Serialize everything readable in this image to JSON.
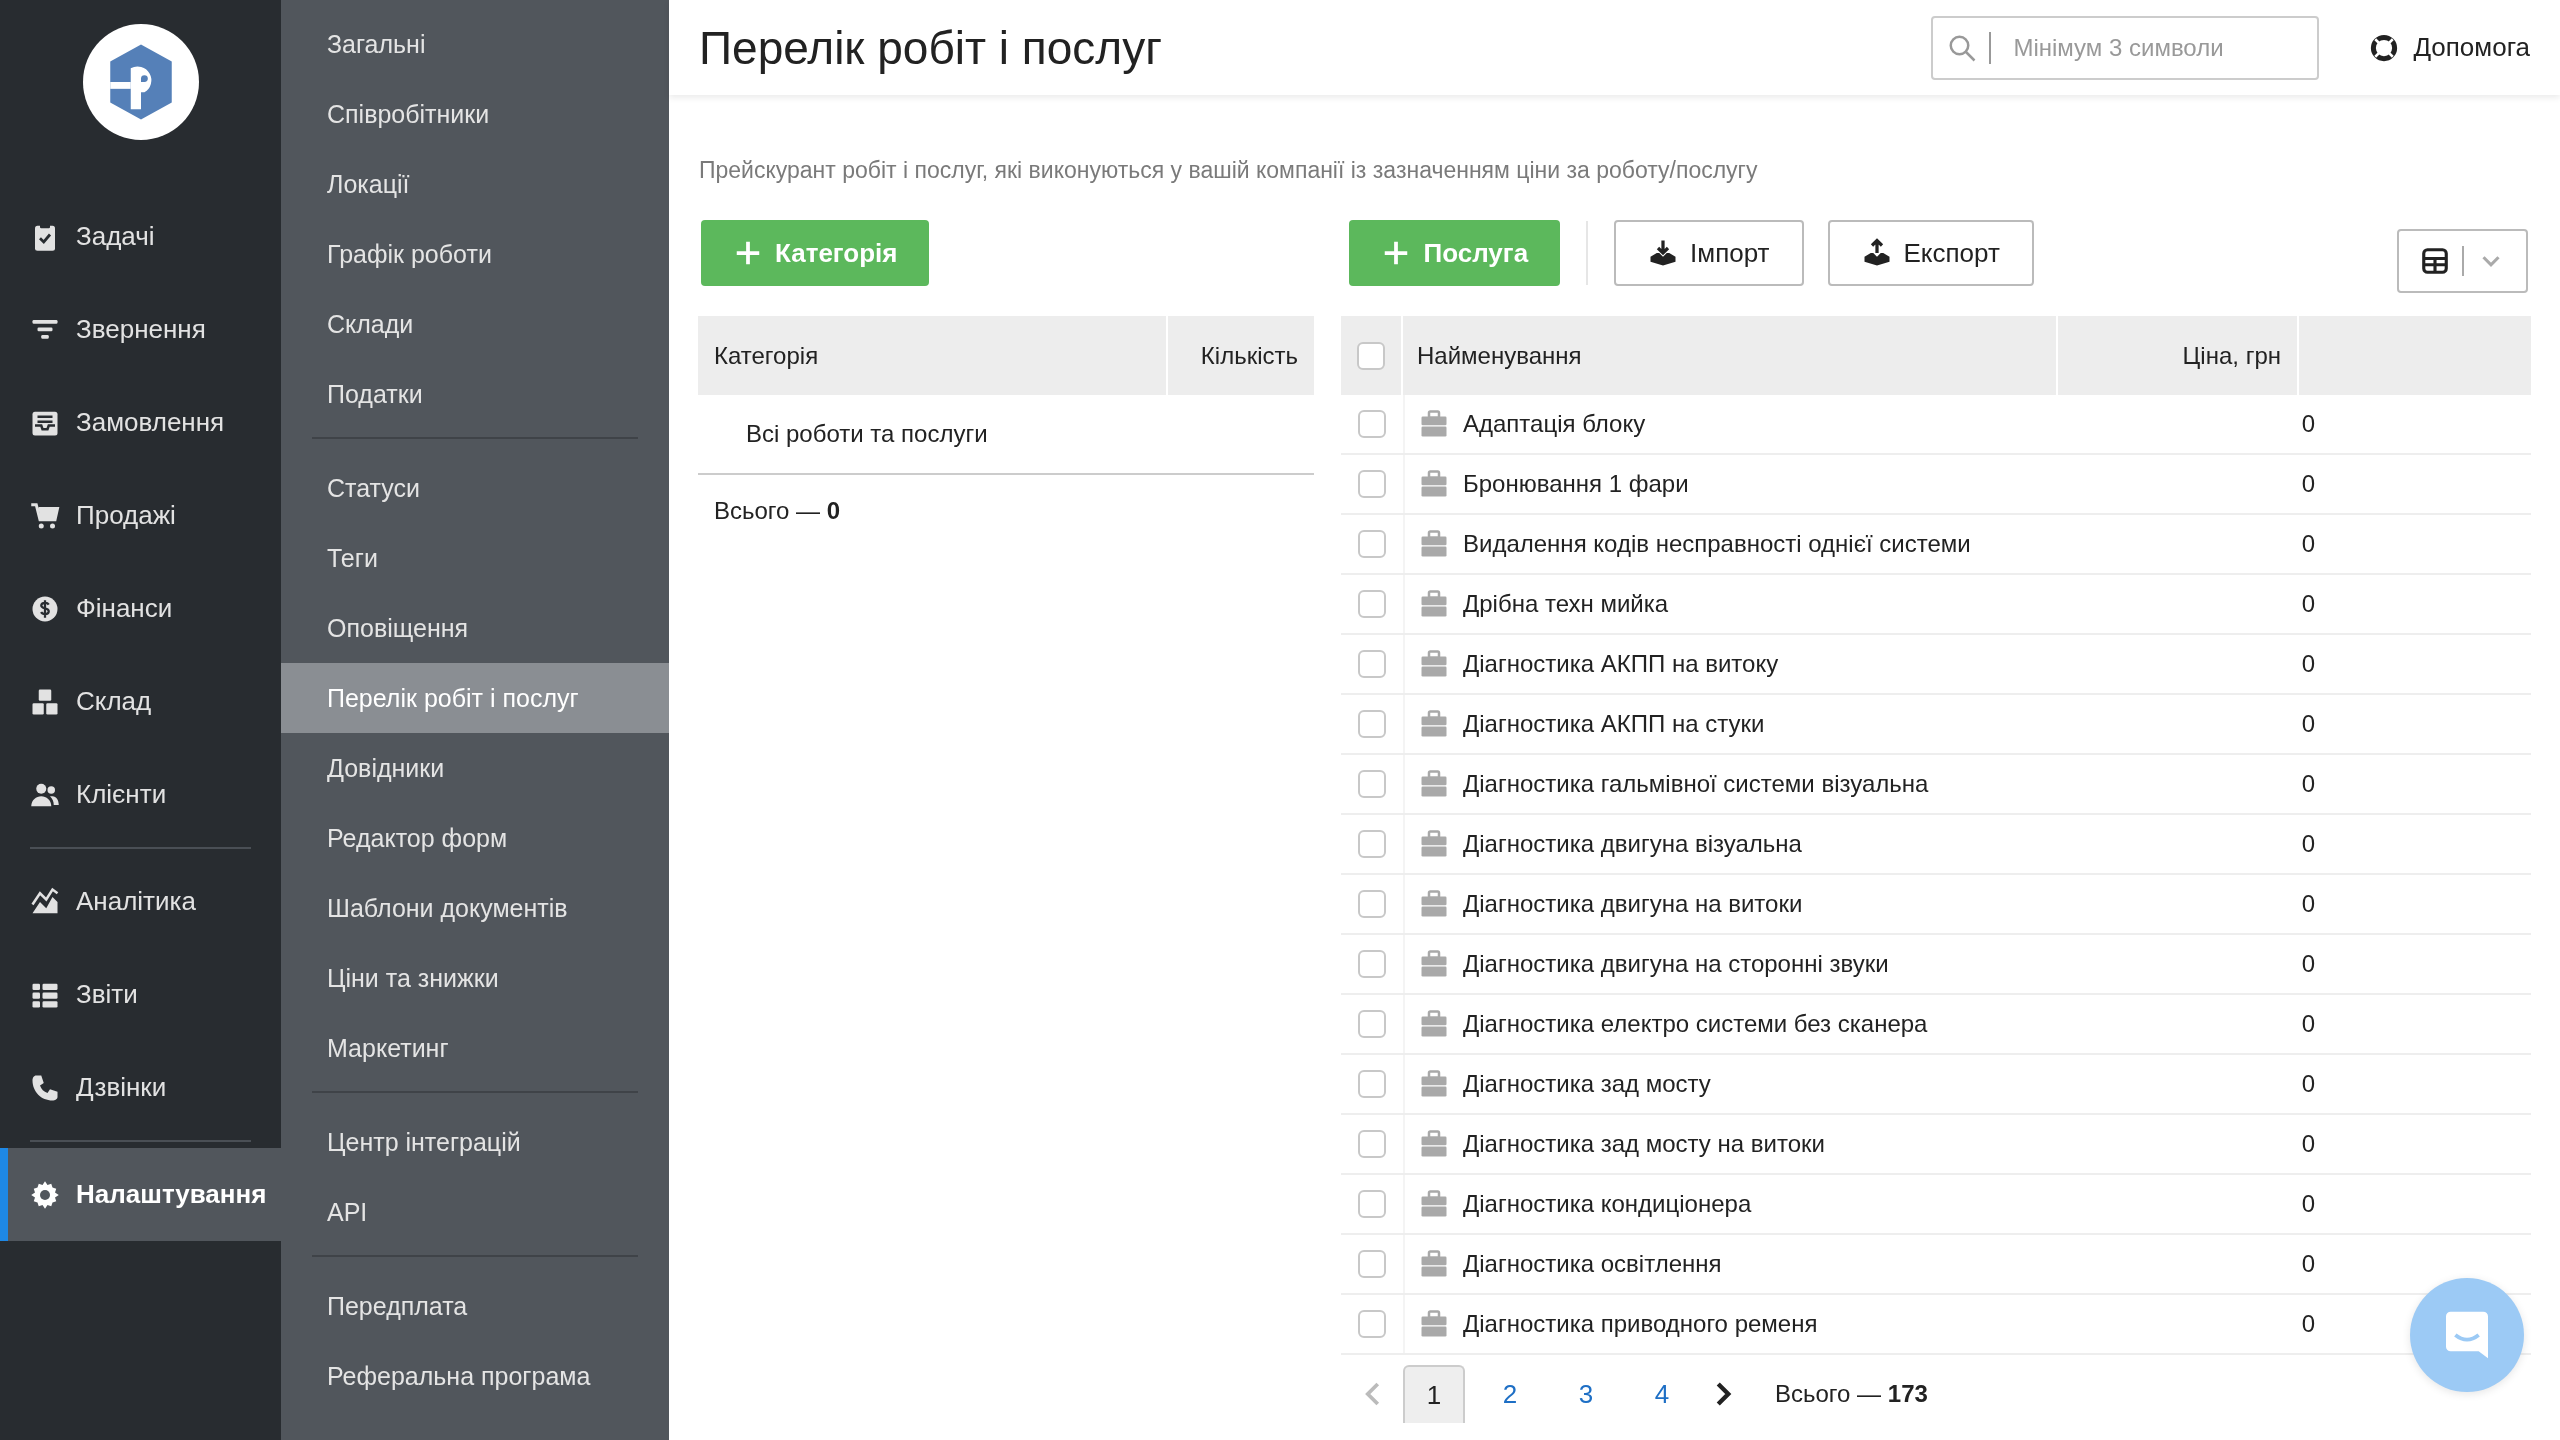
{
  "nav": {
    "groups": [
      [
        {
          "label": "Задачі",
          "selected": false
        },
        {
          "label": "Звернення",
          "selected": false
        },
        {
          "label": "Замовлення",
          "selected": false
        },
        {
          "label": "Продажі",
          "selected": false
        },
        {
          "label": "Фінанси",
          "selected": false
        },
        {
          "label": "Склад",
          "selected": false
        },
        {
          "label": "Клієнти",
          "selected": false
        }
      ],
      [
        {
          "label": "Аналітика",
          "selected": false
        },
        {
          "label": "Звіти",
          "selected": false
        },
        {
          "label": "Дзвінки",
          "selected": false
        }
      ],
      [
        {
          "label": "Налаштування",
          "selected": true
        }
      ]
    ]
  },
  "submenu": {
    "groups": [
      [
        {
          "label": "Загальні",
          "selected": false
        },
        {
          "label": "Співробітники",
          "selected": false
        },
        {
          "label": "Локації",
          "selected": false
        },
        {
          "label": "Графік роботи",
          "selected": false
        },
        {
          "label": "Склади",
          "selected": false
        },
        {
          "label": "Податки",
          "selected": false
        }
      ],
      [
        {
          "label": "Статуси",
          "selected": false
        },
        {
          "label": "Теги",
          "selected": false
        },
        {
          "label": "Оповіщення",
          "selected": false
        },
        {
          "label": "Перелік робіт і послуг",
          "selected": true
        },
        {
          "label": "Довідники",
          "selected": false
        },
        {
          "label": "Редактор форм",
          "selected": false
        },
        {
          "label": "Шаблони документів",
          "selected": false
        },
        {
          "label": "Ціни та знижки",
          "selected": false
        },
        {
          "label": "Маркетинг",
          "selected": false
        }
      ],
      [
        {
          "label": "Центр інтеграцій",
          "selected": false
        },
        {
          "label": "API",
          "selected": false
        }
      ],
      [
        {
          "label": "Передплата",
          "selected": false
        },
        {
          "label": "Реферальна програма",
          "selected": false
        }
      ]
    ]
  },
  "header": {
    "title": "Перелік робіт і послуг",
    "search": {
      "placeholder": "Мінімум 3 символи"
    },
    "help": "Допомога"
  },
  "description": "Прейскурант робіт і послуг, які виконуються у вашій компанії із зазначенням ціни за роботу/послугу",
  "toolbar": {
    "add_category": "Категорія",
    "add_service": "Послуга",
    "import": "Імпорт",
    "export": "Експорт"
  },
  "categories": {
    "columns": [
      "Категорія",
      "Кількість"
    ],
    "rows": [
      {
        "name": "Всі роботи та послуги"
      }
    ],
    "total_label": "Всього —",
    "total": "0"
  },
  "services": {
    "columns": [
      "Найменування",
      "Ціна, грн"
    ],
    "select_all_checked": false,
    "rows": [
      {
        "name": "Адаптація блоку",
        "price": "0",
        "checked": false
      },
      {
        "name": "Бронювання 1 фари",
        "price": "0",
        "checked": false
      },
      {
        "name": "Видалення кодів несправності однієї системи",
        "price": "0",
        "checked": false
      },
      {
        "name": "Дрібна техн мийка",
        "price": "0",
        "checked": false
      },
      {
        "name": "Діагностика АКПП на витоку",
        "price": "0",
        "checked": false
      },
      {
        "name": "Діагностика АКПП на стуки",
        "price": "0",
        "checked": false
      },
      {
        "name": "Діагностика гальмівної системи візуальна",
        "price": "0",
        "checked": false
      },
      {
        "name": "Діагностика двигуна візуальна",
        "price": "0",
        "checked": false
      },
      {
        "name": "Діагностика двигуна на витоки",
        "price": "0",
        "checked": false
      },
      {
        "name": "Діагностика двигуна на сторонні звуки",
        "price": "0",
        "checked": false
      },
      {
        "name": "Діагностика електро системи без сканера",
        "price": "0",
        "checked": false
      },
      {
        "name": "Діагностика зад мосту",
        "price": "0",
        "checked": false
      },
      {
        "name": "Діагностика зад мосту на витоки",
        "price": "0",
        "checked": false
      },
      {
        "name": "Діагностика кондиціонера",
        "price": "0",
        "checked": false
      },
      {
        "name": "Діагностика освітлення",
        "price": "0",
        "checked": false
      },
      {
        "name": "Діагностика приводного ременя",
        "price": "0",
        "checked": false
      }
    ]
  },
  "pagination": {
    "prev_disabled": true,
    "next_disabled": false,
    "pages": [
      {
        "label": "1",
        "selected": true
      },
      {
        "label": "2",
        "selected": false
      },
      {
        "label": "3",
        "selected": false
      },
      {
        "label": "4",
        "selected": false
      }
    ],
    "total_label": "Всього —",
    "total": "173"
  }
}
